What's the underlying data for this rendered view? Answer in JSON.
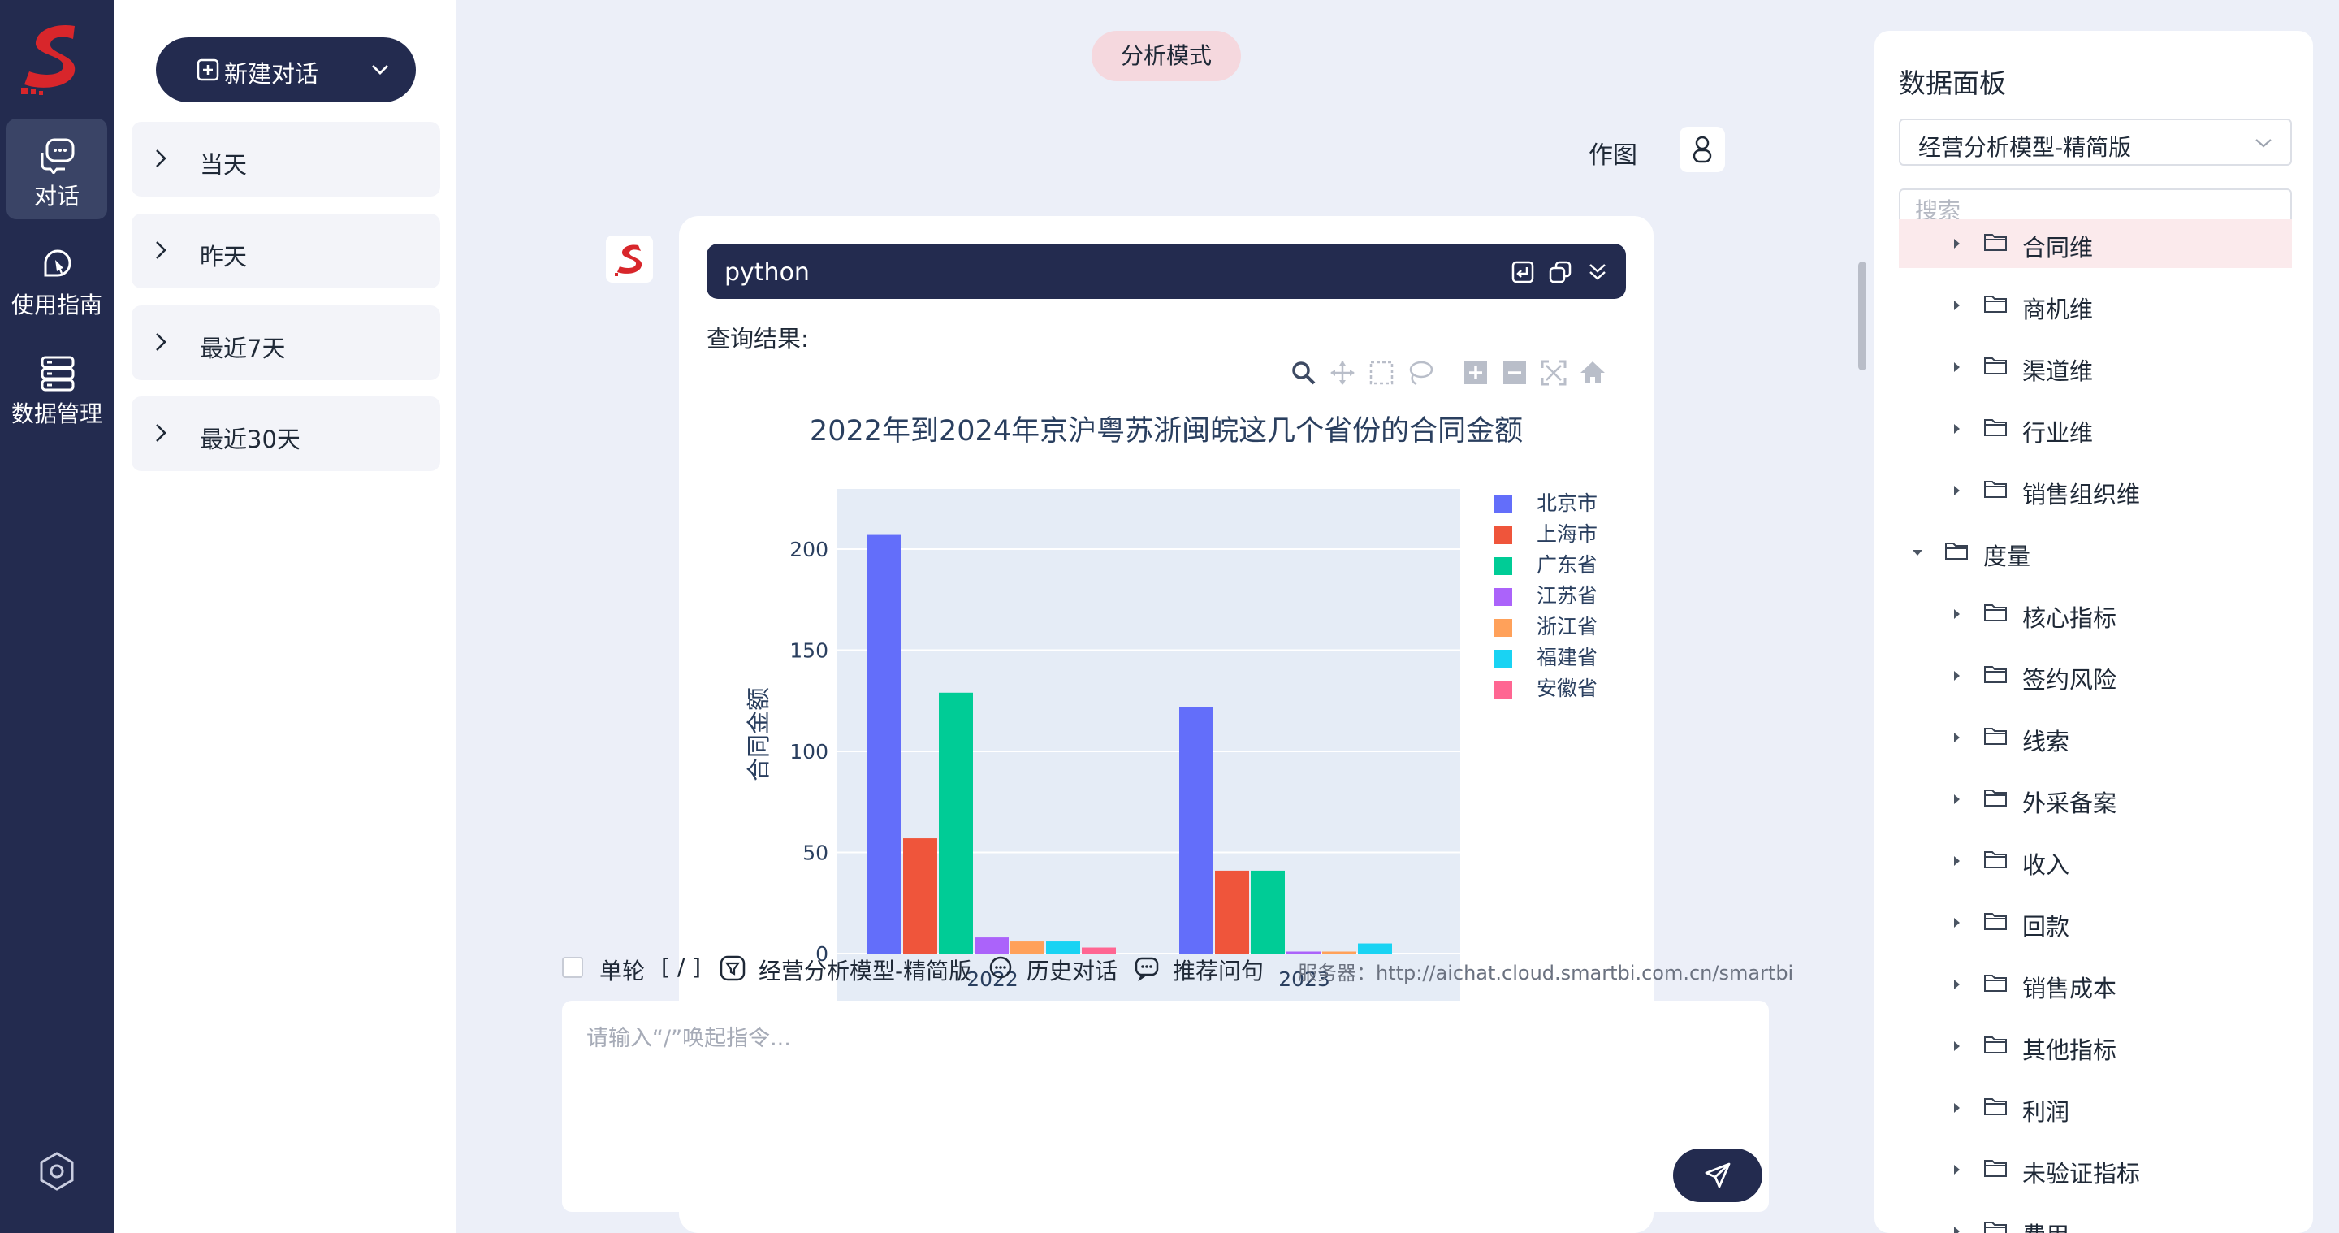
{
  "nav": {
    "items": [
      {
        "label": "对话",
        "icon": "chat-icon",
        "active": true
      },
      {
        "label": "使用指南",
        "icon": "guide-icon",
        "active": false
      },
      {
        "label": "数据管理",
        "icon": "database-icon",
        "active": false
      }
    ],
    "settings_icon": "settings-hex-icon"
  },
  "history": {
    "new_chat_label": "新建对话",
    "groups": [
      "当天",
      "昨天",
      "最近7天",
      "最近30天"
    ]
  },
  "main": {
    "mode_label": "分析模式",
    "user_message": "作图",
    "code_block": {
      "language": "python"
    },
    "result_label": "查询结果:"
  },
  "chart_data": {
    "type": "bar",
    "title": "2022年到2024年京沪粤苏浙闽皖这几个省份的合同金额",
    "ylabel": "合同金额",
    "xlabel": "",
    "categories": [
      "2022",
      "2023"
    ],
    "yticks": [
      "0",
      "50",
      "100",
      "150",
      "200"
    ],
    "ylim": [
      0,
      220
    ],
    "grid": true,
    "legend_position": "right",
    "series": [
      {
        "name": "北京市",
        "color": "#636efa",
        "values": [
          207,
          122
        ]
      },
      {
        "name": "上海市",
        "color": "#ef553b",
        "values": [
          57,
          41
        ]
      },
      {
        "name": "广东省",
        "color": "#00cc96",
        "values": [
          129,
          41
        ]
      },
      {
        "name": "江苏省",
        "color": "#ab63fa",
        "values": [
          8,
          1
        ]
      },
      {
        "name": "浙江省",
        "color": "#ffa15a",
        "values": [
          6,
          1
        ]
      },
      {
        "name": "福建省",
        "color": "#19d3f3",
        "values": [
          6,
          5
        ]
      },
      {
        "name": "安徽省",
        "color": "#ff6692",
        "values": [
          3,
          0
        ]
      }
    ]
  },
  "input": {
    "single_turn_label": "单轮",
    "slash_hint": "[ / ]",
    "model_label": "经营分析模型-精简版",
    "history_label": "历史对话",
    "recommend_label": "推荐问句",
    "server_label": "服务器：http://aichat.cloud.smartbi.com.cn/smartbi",
    "placeholder": "请输入“/”唤起指令..."
  },
  "data_panel": {
    "title": "数据面板",
    "selected_model": "经营分析模型-精简版",
    "search_placeholder": "搜索",
    "tree": [
      {
        "label": "合同维",
        "level": 2,
        "expanded": false,
        "selected": true
      },
      {
        "label": "商机维",
        "level": 2,
        "expanded": false,
        "selected": false
      },
      {
        "label": "渠道维",
        "level": 2,
        "expanded": false,
        "selected": false
      },
      {
        "label": "行业维",
        "level": 2,
        "expanded": false,
        "selected": false
      },
      {
        "label": "销售组织维",
        "level": 2,
        "expanded": false,
        "selected": false
      },
      {
        "label": "度量",
        "level": 1,
        "expanded": true,
        "selected": false
      },
      {
        "label": "核心指标",
        "level": 2,
        "expanded": false,
        "selected": false
      },
      {
        "label": "签约风险",
        "level": 2,
        "expanded": false,
        "selected": false
      },
      {
        "label": "线索",
        "level": 2,
        "expanded": false,
        "selected": false
      },
      {
        "label": "外采备案",
        "level": 2,
        "expanded": false,
        "selected": false
      },
      {
        "label": "收入",
        "level": 2,
        "expanded": false,
        "selected": false
      },
      {
        "label": "回款",
        "level": 2,
        "expanded": false,
        "selected": false
      },
      {
        "label": "销售成本",
        "level": 2,
        "expanded": false,
        "selected": false
      },
      {
        "label": "其他指标",
        "level": 2,
        "expanded": false,
        "selected": false
      },
      {
        "label": "利润",
        "level": 2,
        "expanded": false,
        "selected": false
      },
      {
        "label": "未验证指标",
        "level": 2,
        "expanded": false,
        "selected": false
      },
      {
        "label": "费用",
        "level": 2,
        "expanded": false,
        "selected": false
      }
    ]
  }
}
